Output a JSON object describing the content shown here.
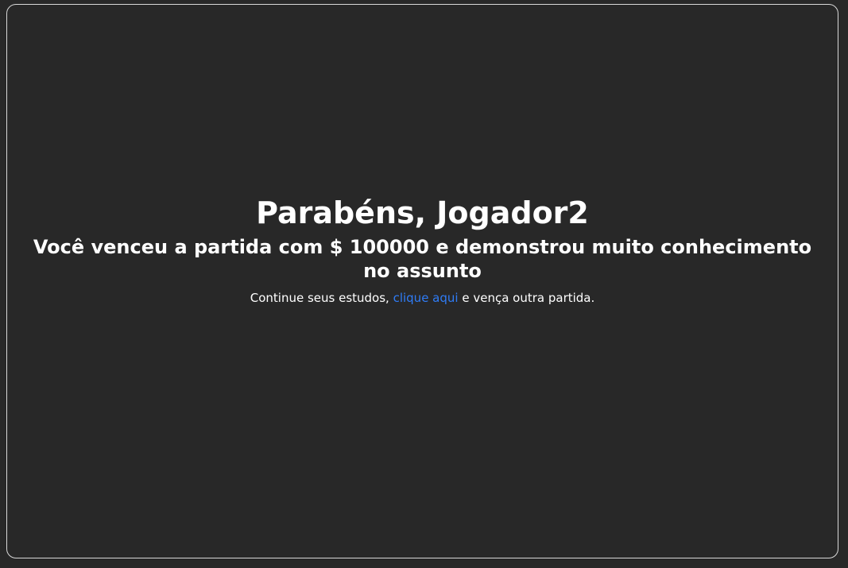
{
  "congrats": {
    "title": "Parabéns, Jogador2",
    "subtitle": "Você venceu a partida com $ 100000 e demonstrou muito conhecimento no assunto",
    "message_before": "Continue seus estudos, ",
    "link_label": "clique aqui",
    "message_after": " e vença outra partida."
  },
  "colors": {
    "background": "#282828",
    "text": "#ffffff",
    "link": "#2f7cf6",
    "border": "#d9d9d9"
  }
}
